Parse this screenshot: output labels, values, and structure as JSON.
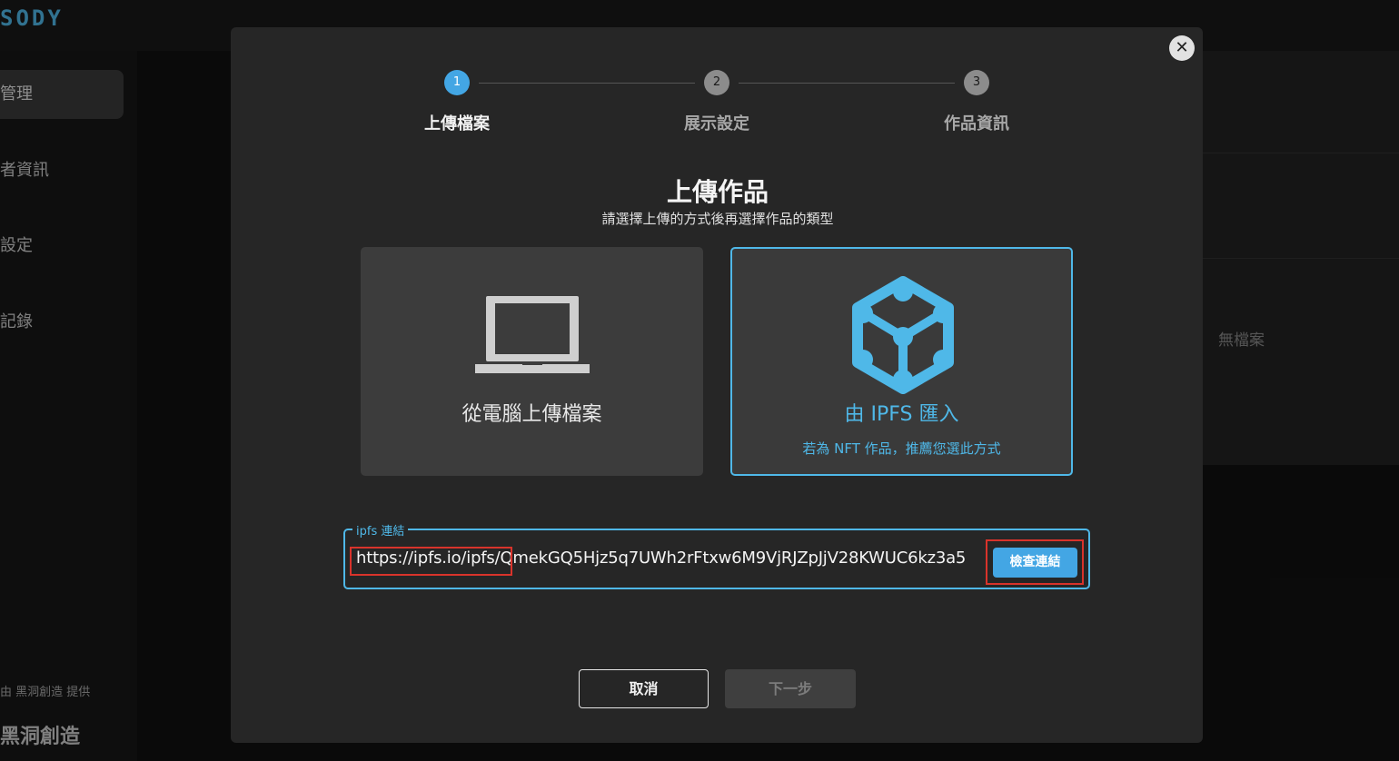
{
  "app": {
    "brand": "SODY"
  },
  "sidebar": {
    "items": [
      {
        "label": "管理"
      },
      {
        "label": "者資訊"
      },
      {
        "label": "設定"
      },
      {
        "label": "記錄"
      }
    ],
    "footer_provided": "由 黑洞創造 提供",
    "footer_logo": "黑洞創造"
  },
  "background": {
    "no_files": "無檔案"
  },
  "modal": {
    "close_label": "✕",
    "steps": [
      {
        "number": "1",
        "label": "上傳檔案",
        "active": true
      },
      {
        "number": "2",
        "label": "展示設定",
        "active": false
      },
      {
        "number": "3",
        "label": "作品資訊",
        "active": false
      }
    ],
    "title": "上傳作品",
    "subtitle": "請選擇上傳的方式後再選擇作品的類型",
    "options": {
      "computer": {
        "label": "從電腦上傳檔案",
        "icon": "laptop-icon"
      },
      "ipfs": {
        "label": "由 IPFS 匯入",
        "note": "若為 NFT 作品，推薦您選此方式",
        "icon": "ipfs-cube-icon",
        "selected": true
      }
    },
    "ipfs_field": {
      "legend": "ipfs 連結",
      "value": "https://ipfs.io/ipfs/QmekGQ5Hjz5q7UWh2rFtxw6M9VjRJZpJjV28KWUC6kz3a5"
    },
    "check_button": "檢查連結",
    "cancel_button": "取消",
    "next_button": "下一步"
  },
  "colors": {
    "accent": "#43a6e4",
    "ipfs_blue": "#4fb8e8",
    "highlight_red": "#d9332b"
  }
}
